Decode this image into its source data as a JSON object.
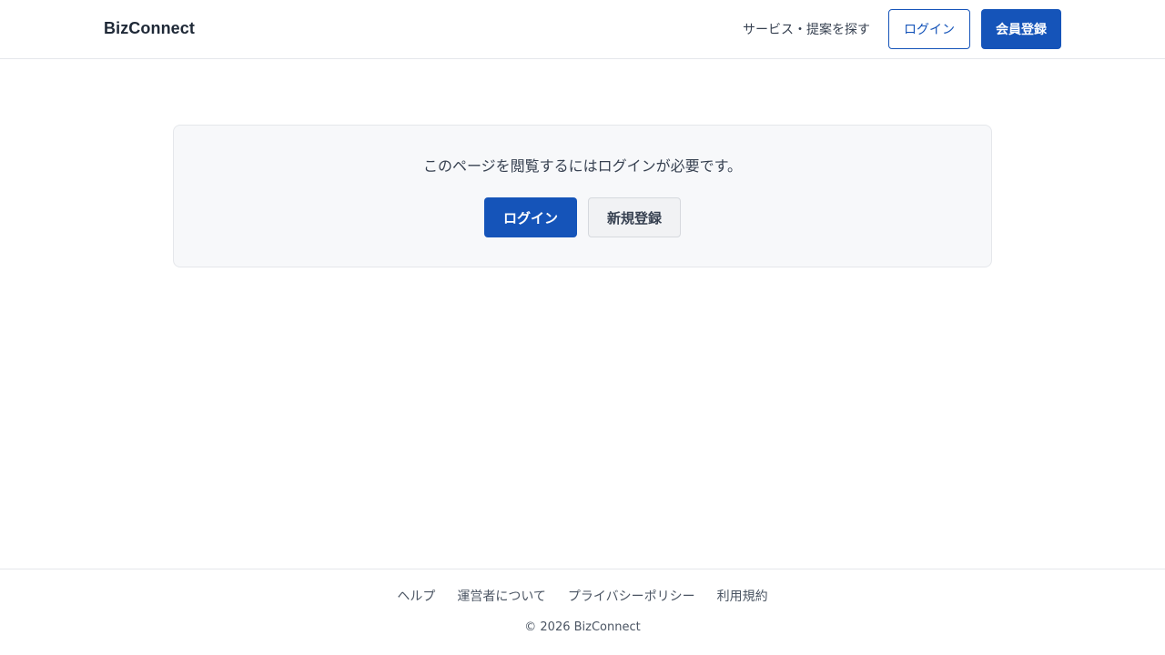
{
  "header": {
    "brand": "BizConnect",
    "nav_link": "サービス・提案を探す",
    "login_label": "ログイン",
    "register_label": "会員登録"
  },
  "notice": {
    "message": "このページを閲覧するにはログインが必要です。",
    "login_label": "ログイン",
    "signup_label": "新規登録"
  },
  "footer": {
    "links": [
      "ヘルプ",
      "運営者について",
      "プライバシーポリシー",
      "利用規約"
    ],
    "copyright": "© 2026 BizConnect"
  },
  "colors": {
    "primary": "#1554b9",
    "card_background": "#f7f8fa",
    "border": "#e5e7eb"
  }
}
